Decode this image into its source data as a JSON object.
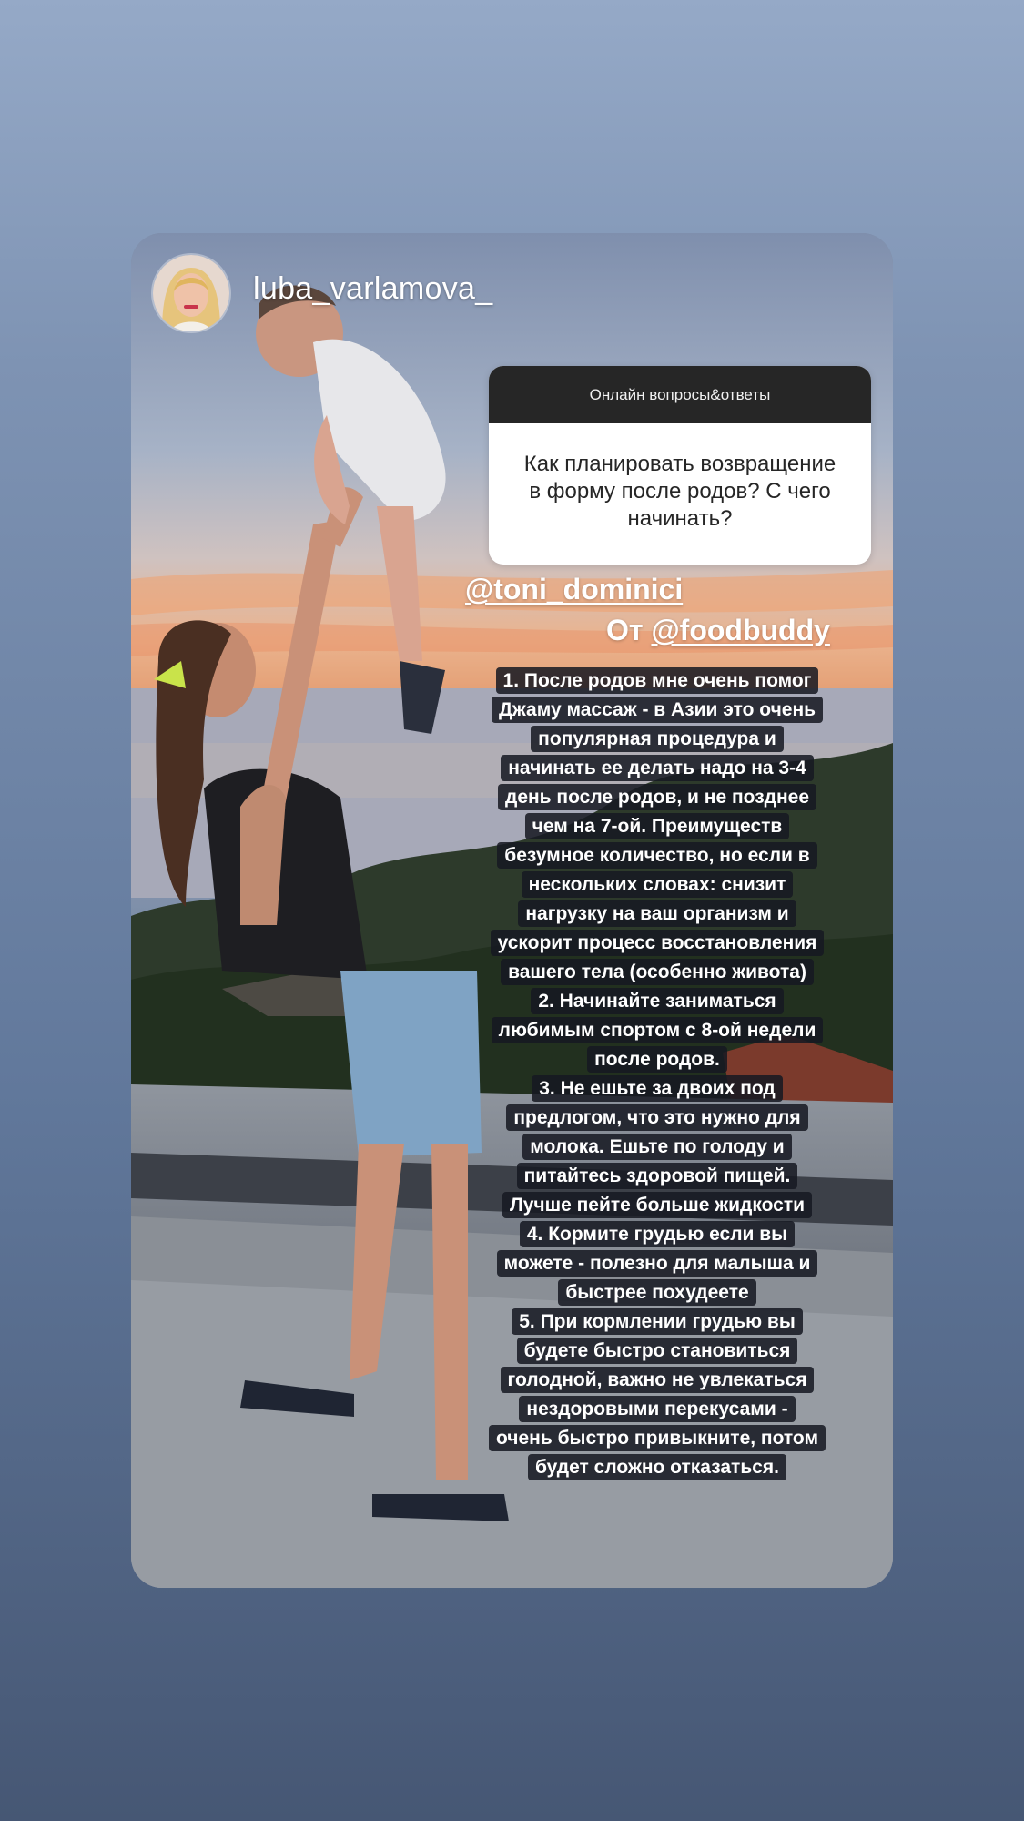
{
  "story": {
    "username": "luba_varlamova_",
    "avatar_icon": "avatar-photo-icon",
    "qa_sticker": {
      "header": "Онлайн вопросы&ответы",
      "question": "Как планировать возвращение в форму после родов? С чего начинать?"
    },
    "mentions": {
      "toni": "@toni_dominici",
      "from_prefix": "От ",
      "foodbuddy": "@foodbuddy"
    },
    "caption_lines": [
      "1. После родов мне очень помог",
      "Джаму массаж - в Азии это очень",
      "популярная процедура и",
      "начинать ее делать надо на 3-4",
      "день после родов, и не позднее",
      "чем на 7-ой. Преимуществ",
      "безумное количество, но если в",
      "нескольких словах: снизит",
      "нагрузку на ваш организм и",
      "ускорит процесс восстановления",
      "вашего тела (особенно живота)",
      "2. Начинайте заниматься",
      "любимым спортом с 8-ой недели",
      "после родов.",
      "3. Не ешьте за двоих под",
      "предлогом, что это нужно для",
      "молока. Ешьте по голоду и",
      "питайтесь здоровой пищей.",
      "Лучше пейте больше жидкости",
      "4. Кормите грудью если вы",
      "можете - полезно для малыша и",
      "быстрее похудеете",
      "5. При кормлении грудью вы",
      "будете быстро становиться",
      "голодной, важно не увлекаться",
      "нездоровыми перекусами -",
      "очень быстро привыкните, потом",
      "будет сложно отказаться."
    ]
  },
  "colors": {
    "background_top": "#95a9c7",
    "background_bottom": "#465774",
    "qa_header_bg": "#262626",
    "caption_bg": "#161922"
  }
}
